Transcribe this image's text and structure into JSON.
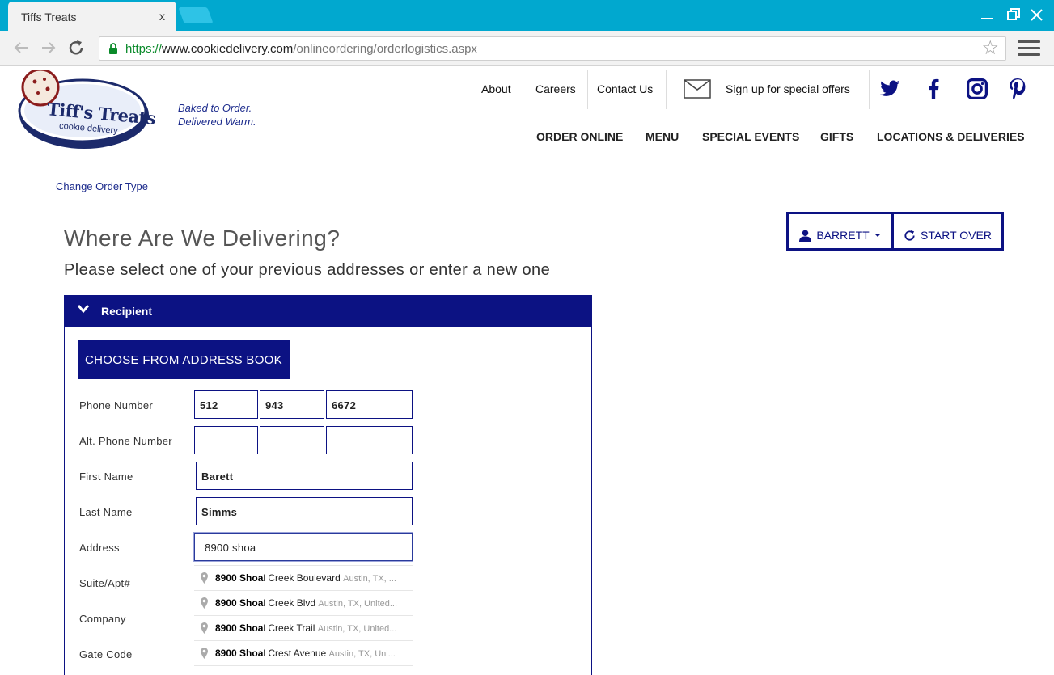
{
  "browser": {
    "tab_title": "Tiffs Treats",
    "tab_close": "x",
    "url": {
      "protocol": "https://",
      "host": "www.cookiedelivery.com",
      "path": "/onlineordering/orderlogistics.aspx"
    }
  },
  "site": {
    "logo_text": "Tiff's Treats",
    "logo_subtext": "cookie delivery",
    "tagline_1": "Baked to Order.",
    "tagline_2": "Delivered Warm.",
    "top_links": [
      "About",
      "Careers",
      "Contact Us"
    ],
    "signup": "Sign up for special offers",
    "social": [
      "twitter-icon",
      "facebook-icon",
      "instagram-icon",
      "pinterest-icon"
    ],
    "main_nav": [
      "ORDER ONLINE",
      "MENU",
      "SPECIAL EVENTS",
      "GIFTS",
      "LOCATIONS & DELIVERIES"
    ]
  },
  "page": {
    "change_order": "Change Order Type",
    "title": "Where Are We Delivering?",
    "subtitle": "Please select one of your previous addresses or enter a new one",
    "user_button": "BARRETT",
    "start_over": "START OVER"
  },
  "panel": {
    "header": "Recipient",
    "address_book_button": "CHOOSE FROM ADDRESS BOOK",
    "labels": {
      "phone": "Phone Number",
      "alt_phone": "Alt. Phone Number",
      "first_name": "First Name",
      "last_name": "Last Name",
      "address": "Address",
      "suite": "Suite/Apt#",
      "company": "Company",
      "gate": "Gate Code"
    },
    "values": {
      "phone_1": "512",
      "phone_2": "943",
      "phone_3": "6672",
      "alt_1": "",
      "alt_2": "",
      "alt_3": "",
      "first_name": "Barett",
      "last_name": "Simms",
      "address": "8900 shoa"
    },
    "suggestions": [
      {
        "match": "8900 Shoa",
        "rest": "l Creek Boulevard",
        "secondary": "Austin, TX, ..."
      },
      {
        "match": "8900 Shoa",
        "rest": "l Creek Blvd",
        "secondary": "Austin, TX, United..."
      },
      {
        "match": "8900 Shoa",
        "rest": "l Creek Trail",
        "secondary": "Austin, TX, United..."
      },
      {
        "match": "8900 Shoa",
        "rest": "l Crest Avenue",
        "secondary": "Austin, TX, Uni..."
      }
    ]
  },
  "colors": {
    "chrome": "#01a8cf",
    "brand": "#0c1283"
  }
}
